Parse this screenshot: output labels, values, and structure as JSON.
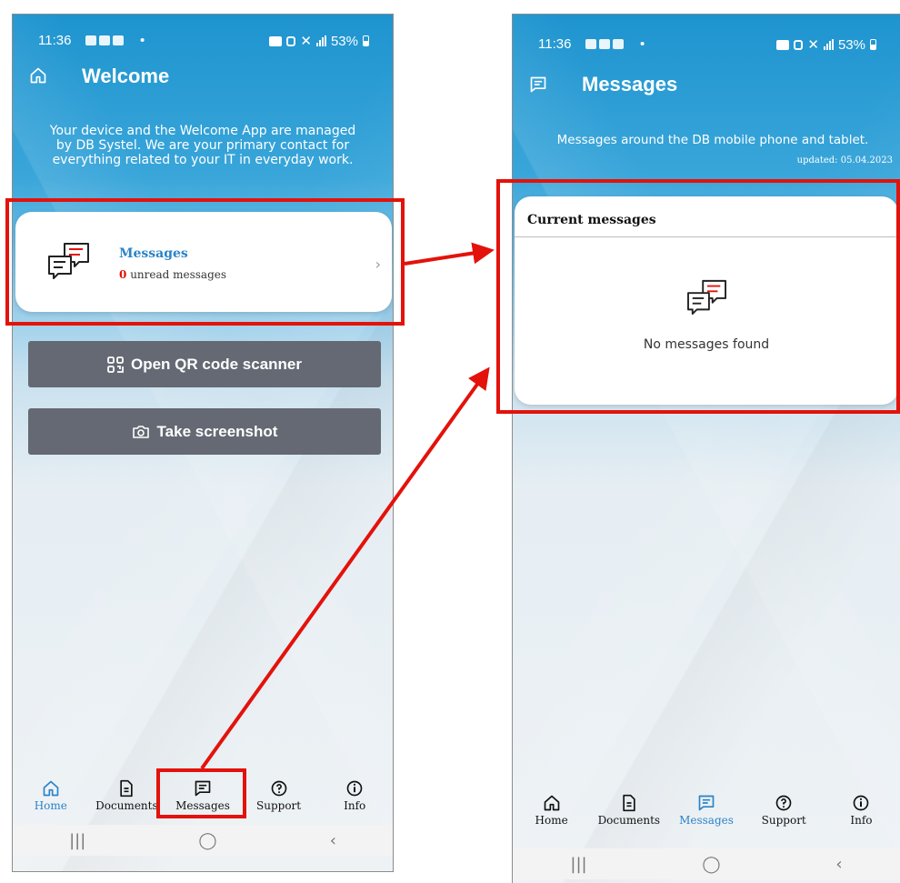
{
  "status_bar": {
    "time": "11:36",
    "battery": "53%"
  },
  "screen_welcome": {
    "title": "Welcome",
    "intro": "Your device and the Welcome App are managed by DB Systel. We are your primary contact for everything related to your IT in everyday work.",
    "messages_card": {
      "title": "Messages",
      "unread_count": "0",
      "unread_label": "unread messages"
    },
    "buttons": {
      "qr": "Open QR code scanner",
      "screenshot": "Take screenshot"
    }
  },
  "screen_messages": {
    "title": "Messages",
    "intro": "Messages around the DB mobile phone and tablet.",
    "updated": "updated: 05.04.2023",
    "current_title": "Current messages",
    "empty_text": "No messages found"
  },
  "nav": [
    {
      "label": "Home",
      "icon": "home-icon"
    },
    {
      "label": "Documents",
      "icon": "document-icon"
    },
    {
      "label": "Messages",
      "icon": "message-icon"
    },
    {
      "label": "Support",
      "icon": "help-icon"
    },
    {
      "label": "Info",
      "icon": "info-icon"
    }
  ],
  "colors": {
    "accent": "#2a83c8",
    "highlight": "#e3120b",
    "button": "#646973"
  }
}
